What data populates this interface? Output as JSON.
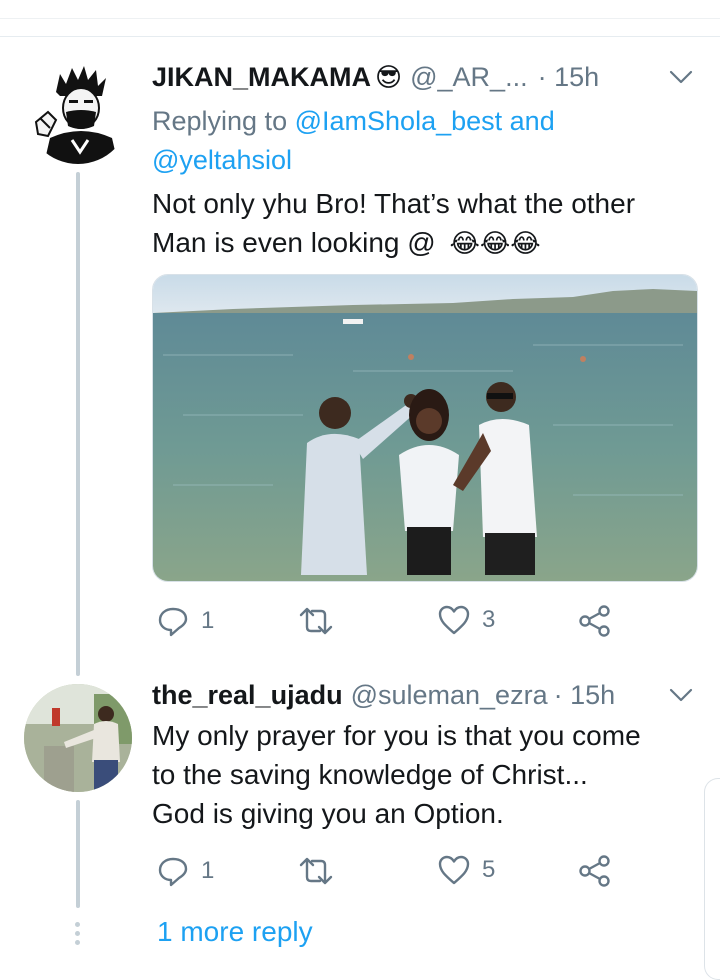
{
  "tweet1": {
    "display_name": "JIKAN_MAKAMA",
    "handle": "@_AR_...",
    "time": "· 15h",
    "reply_prefix": "Replying to",
    "reply_user1": "@IamShola_best",
    "reply_and": "and",
    "reply_user2": "@yeltahsiol",
    "text_line1": "Not only yhu Bro!  That’s what the other",
    "text_line2": "Man is even looking @",
    "emojis": "😂😂😂",
    "name_emoji": "😎",
    "actions": {
      "replies": "1",
      "likes": "3"
    },
    "icons": [
      "reply-icon",
      "retweet-icon",
      "like-icon",
      "share-icon",
      "chevron-down-icon"
    ]
  },
  "tweet2": {
    "display_name": "the_real_ujadu",
    "handle": "@suleman_ezra",
    "time": "· 15h",
    "text_line1": "My only prayer for you is that you come",
    "text_line2": "to the saving knowledge of Christ...",
    "text_line3": "God is giving you an Option.",
    "actions": {
      "replies": "1",
      "likes": "5"
    }
  },
  "more_replies": "1 more reply",
  "colors": {
    "accent": "#1da1f2",
    "muted": "#657786",
    "thread_line": "#c4cfd6"
  }
}
